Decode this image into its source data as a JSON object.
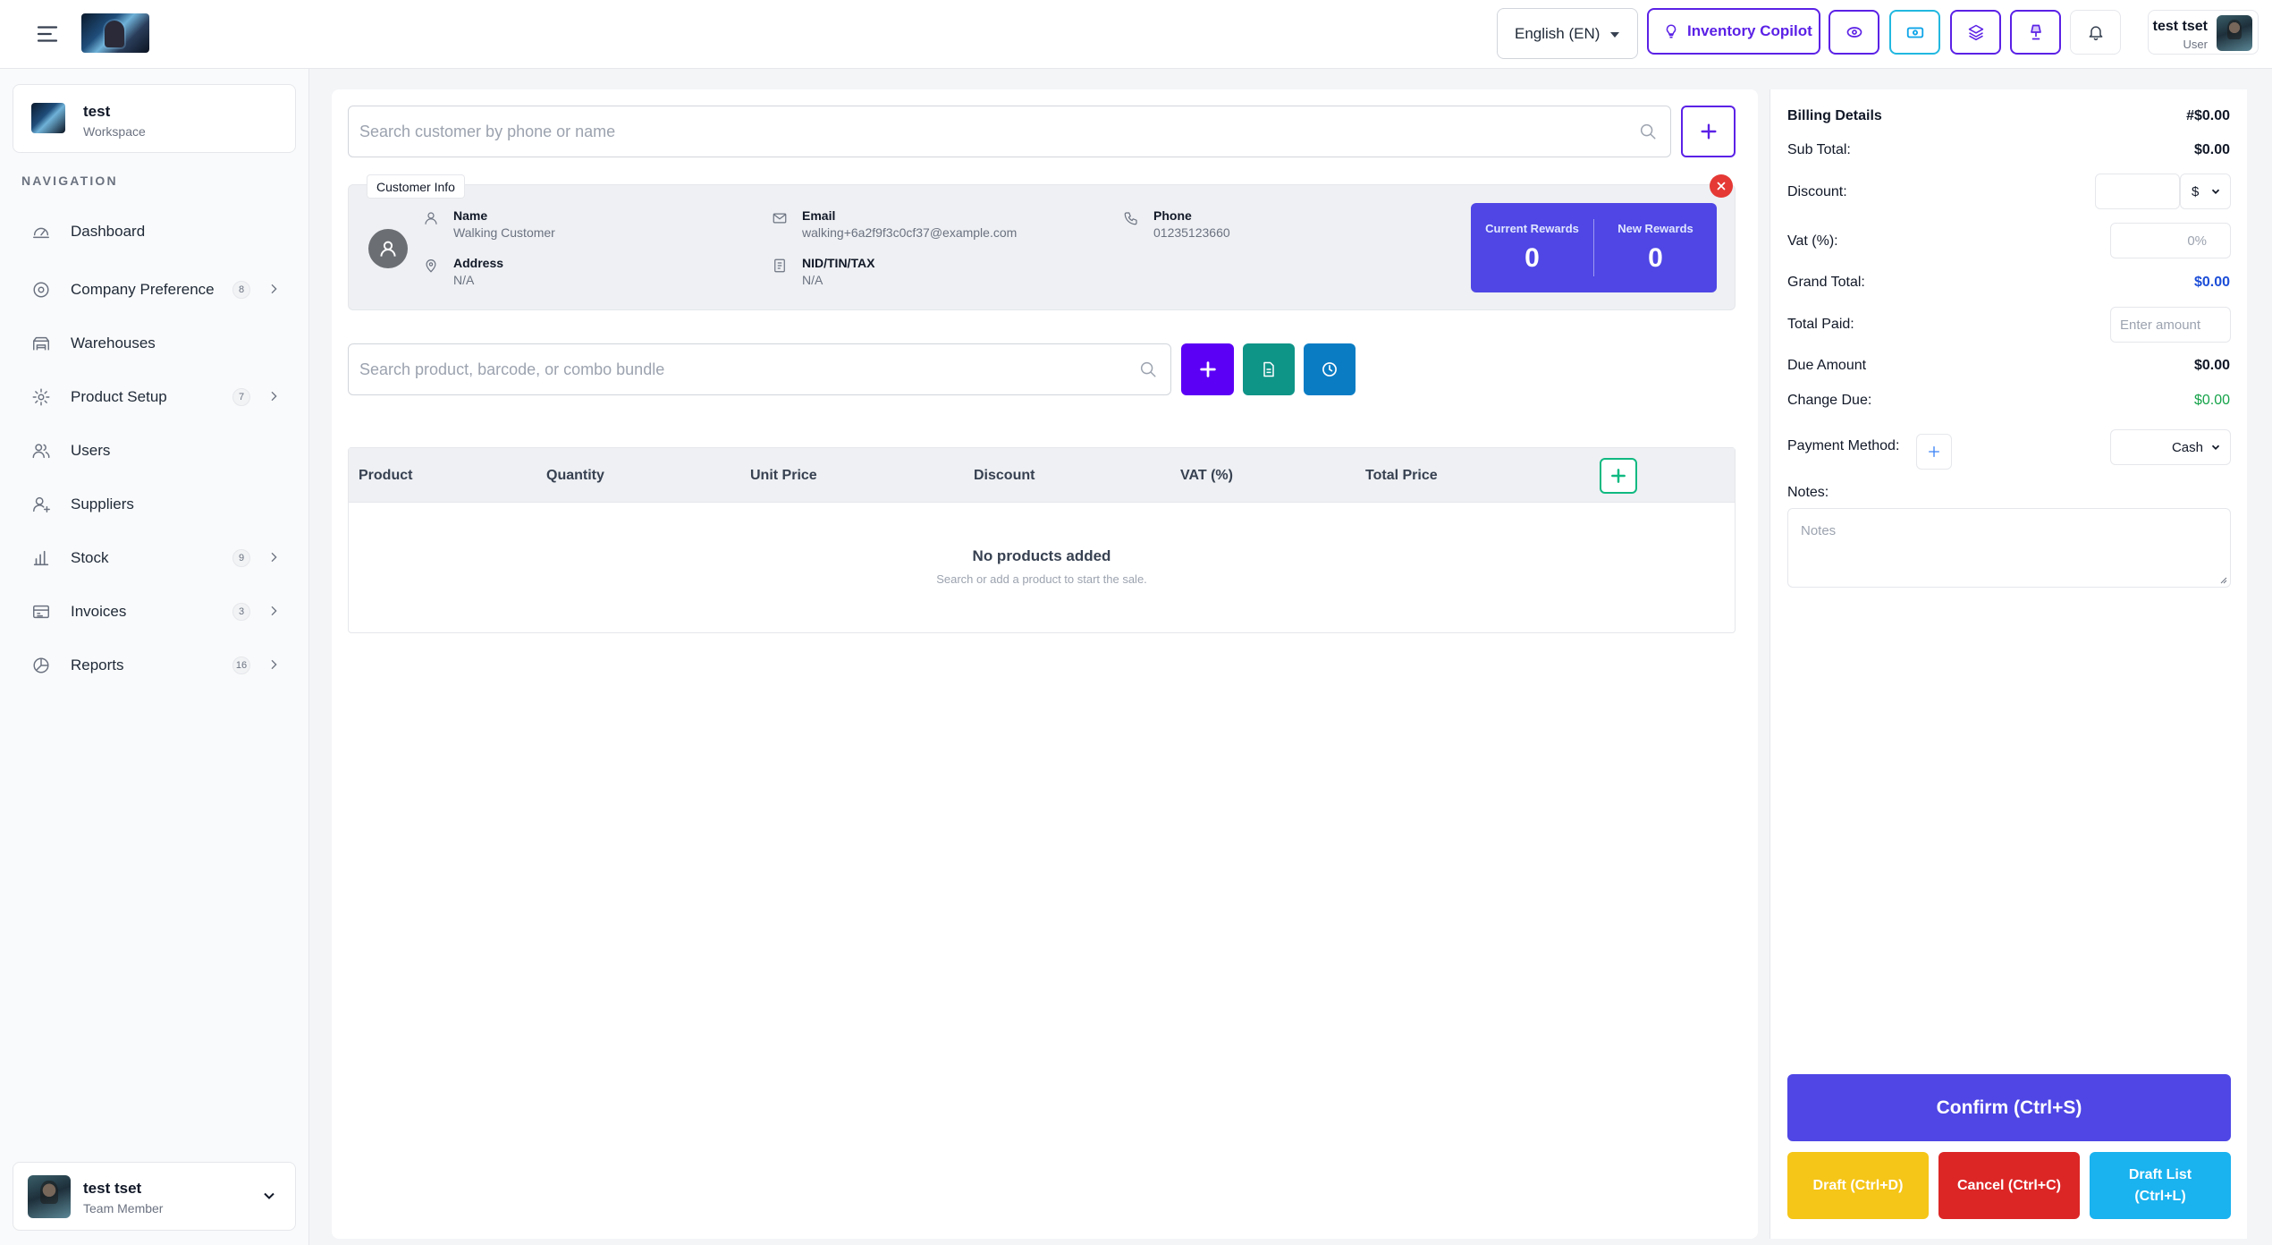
{
  "topbar": {
    "language": "English (EN)",
    "copilot_label": "Inventory Copilot",
    "user_name": "test tset",
    "user_role": "User"
  },
  "sidebar": {
    "workspace_title": "test",
    "workspace_sub": "Workspace",
    "nav_heading": "NAVIGATION",
    "items": [
      {
        "label": "Dashboard",
        "badge": "",
        "icon": "dashboard-icon"
      },
      {
        "label": "Company Preference",
        "badge": "8",
        "icon": "company-icon"
      },
      {
        "label": "Warehouses",
        "badge": "",
        "icon": "warehouse-icon"
      },
      {
        "label": "Product Setup",
        "badge": "7",
        "icon": "gear-icon"
      },
      {
        "label": "Users",
        "badge": "",
        "icon": "users-icon"
      },
      {
        "label": "Suppliers",
        "badge": "",
        "icon": "supplier-icon"
      },
      {
        "label": "Stock",
        "badge": "9",
        "icon": "stock-icon"
      },
      {
        "label": "Invoices",
        "badge": "3",
        "icon": "invoice-icon"
      },
      {
        "label": "Reports",
        "badge": "16",
        "icon": "report-icon"
      }
    ],
    "user_name": "test tset",
    "user_role": "Team Member"
  },
  "customer": {
    "search_placeholder": "Search customer by phone or name",
    "tag": "Customer Info",
    "name_label": "Name",
    "name_value": "Walking Customer",
    "email_label": "Email",
    "email_value": "walking+6a2f9f3c0cf37@example.com",
    "phone_label": "Phone",
    "phone_value": "01235123660",
    "address_label": "Address",
    "address_value": "N/A",
    "nid_label": "NID/TIN/TAX",
    "nid_value": "N/A",
    "current_rewards_label": "Current Rewards",
    "current_rewards_value": "0",
    "new_rewards_label": "New Rewards",
    "new_rewards_value": "0"
  },
  "product": {
    "search_placeholder": "Search product, barcode, or combo bundle"
  },
  "table": {
    "columns": [
      "Product",
      "Quantity",
      "Unit Price",
      "Discount",
      "VAT (%)",
      "Total Price"
    ],
    "empty_title": "No products added",
    "empty_sub": "Search or add a product to start the sale."
  },
  "billing": {
    "title": "Billing Details",
    "invoice_no": "#$0.00",
    "subtotal_label": "Sub Total:",
    "subtotal_value": "$0.00",
    "discount_label": "Discount:",
    "discount_currency": "$",
    "vat_label": "Vat (%):",
    "vat_placeholder": "0%",
    "grand_total_label": "Grand Total:",
    "grand_total_value": "$0.00",
    "total_paid_label": "Total Paid:",
    "total_paid_placeholder": "Enter amount",
    "due_label": "Due Amount",
    "due_value": "$0.00",
    "change_label": "Change Due:",
    "change_value": "$0.00",
    "payment_label": "Payment Method:",
    "payment_value": "Cash",
    "notes_label": "Notes:",
    "notes_placeholder": "Notes",
    "confirm_label": "Confirm (Ctrl+S)",
    "draft_label": "Draft (Ctrl+D)",
    "cancel_label": "Cancel (Ctrl+C)",
    "draft_list_label": "Draft List\n(Ctrl+L)"
  },
  "colors": {
    "primary": "#5b21e6",
    "indigo": "#4f46e5",
    "teal": "#0f9488",
    "blue": "#0a7cc4",
    "green": "#10b981",
    "yellow": "#f5c518",
    "red": "#dc2626",
    "cyan": "#1ab2ef"
  }
}
